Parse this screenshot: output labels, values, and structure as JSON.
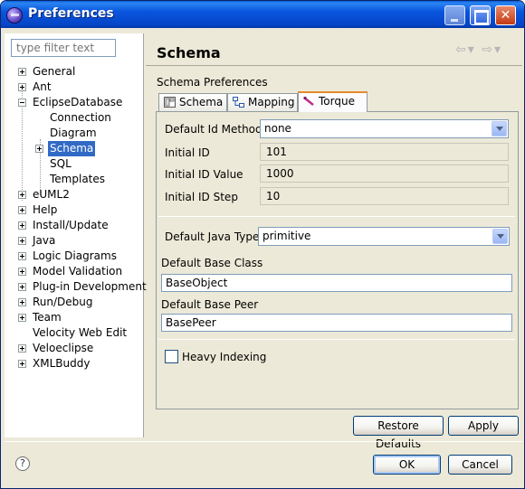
{
  "window": {
    "title": "Preferences"
  },
  "filter": {
    "placeholder": "type filter text"
  },
  "tree": {
    "items": [
      {
        "label": "General"
      },
      {
        "label": "Ant"
      },
      {
        "label": "EclipseDatabase"
      },
      {
        "label": "Connection"
      },
      {
        "label": "Diagram"
      },
      {
        "label": "Schema"
      },
      {
        "label": "SQL"
      },
      {
        "label": "Templates"
      },
      {
        "label": "eUML2"
      },
      {
        "label": "Help"
      },
      {
        "label": "Install/Update"
      },
      {
        "label": "Java"
      },
      {
        "label": "Logic Diagrams"
      },
      {
        "label": "Model Validation"
      },
      {
        "label": "Plug-in Development"
      },
      {
        "label": "Run/Debug"
      },
      {
        "label": "Team"
      },
      {
        "label": "Velocity Web Edit"
      },
      {
        "label": "Veloeclipse"
      },
      {
        "label": "XMLBuddy"
      }
    ]
  },
  "page": {
    "title": "Schema",
    "section": "Schema Preferences"
  },
  "tabs": [
    {
      "label": "Schema"
    },
    {
      "label": "Mapping"
    },
    {
      "label": "Torque"
    }
  ],
  "form": {
    "default_id_method": {
      "label": "Default Id Method",
      "value": "none"
    },
    "initial_id": {
      "label": "Initial ID",
      "value": "101"
    },
    "initial_id_value": {
      "label": "Initial ID Value",
      "value": "1000"
    },
    "initial_id_step": {
      "label": "Initial ID Step",
      "value": "10"
    },
    "default_java_type": {
      "label": "Default Java Type",
      "value": "primitive"
    },
    "default_base_class": {
      "label": "Default Base Class",
      "value": "BaseObject"
    },
    "default_base_peer": {
      "label": "Default Base Peer",
      "value": "BasePeer"
    },
    "heavy_indexing": {
      "label": "Heavy Indexing",
      "checked": false
    }
  },
  "buttons": {
    "restore_defaults": "Restore Defaults",
    "apply": "Apply",
    "ok": "OK",
    "cancel": "Cancel"
  }
}
